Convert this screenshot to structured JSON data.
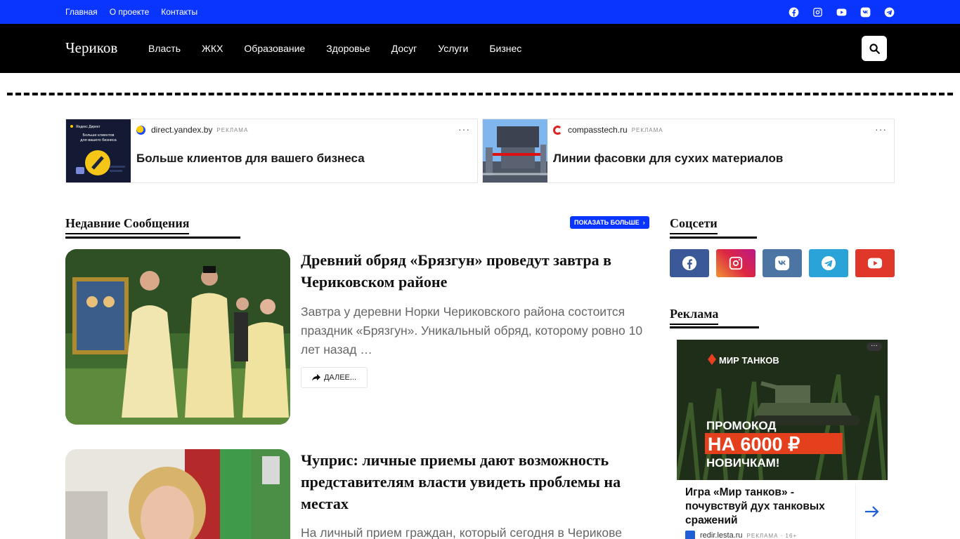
{
  "topbar": {
    "links": [
      "Главная",
      "О проекте",
      "Контакты"
    ],
    "social_icons": [
      "facebook-icon",
      "instagram-icon",
      "youtube-icon",
      "vk-icon",
      "telegram-icon"
    ]
  },
  "header": {
    "logo": "Чериков",
    "nav": [
      "Власть",
      "ЖКХ",
      "Образование",
      "Здоровье",
      "Досуг",
      "Услуги",
      "Бизнес"
    ],
    "search_icon": "search-icon"
  },
  "ads": [
    {
      "domain": "direct.yandex.by",
      "tag": "РЕКЛАМА",
      "headline": "Больше клиентов для вашего бизнеса",
      "thumb_text": "Больше клиентов для вашего бизнеса",
      "thumb_brand": "Яндекс Директ"
    },
    {
      "domain": "compasstech.ru",
      "tag": "РЕКЛАМА",
      "headline": "Линии фасовки для сухих материалов"
    }
  ],
  "recent": {
    "title": "Недавние Сообщения",
    "more_label": "ПОКАЗАТЬ БОЛЬШЕ",
    "posts": [
      {
        "title": "Древний обряд «Брязгун» проведут завтра в Чериковском районе",
        "excerpt": "Завтра у деревни Норки Чериковского района состоится праздник «Брязгун». Уникальный обряд, которому ровно 10 лет назад …",
        "read_more": "ДАЛЕЕ..."
      },
      {
        "title": "Чуприс: личные приемы дают возможность представителям власти увидеть проблемы на местах",
        "excerpt": "На личный прием граждан, который сегодня в Черикове"
      }
    ]
  },
  "sidebar": {
    "social_title": "Соцсети",
    "social_buttons": [
      {
        "icon": "facebook-icon",
        "color": "#3b5998"
      },
      {
        "icon": "instagram-icon",
        "color": "#c13584"
      },
      {
        "icon": "vk-icon",
        "color": "#4c75a3"
      },
      {
        "icon": "telegram-icon",
        "color": "#2aa3d9"
      },
      {
        "icon": "youtube-icon",
        "color": "#e0372b"
      }
    ],
    "ad_title": "Реклама",
    "ad": {
      "brand": "МИР ТАНКОВ",
      "promo1": "ПРОМОКОД",
      "promo2": "НА 6000 ₽",
      "promo3": "НОВИЧКАМ!",
      "caption": "Игра «Мир танков» - почувствуй дух танковых сражений",
      "domain": "redir.lesta.ru",
      "tag": "РЕКЛАМА · 16+"
    }
  },
  "colors": {
    "brand_blue": "#0a35ff",
    "header_bg": "#000000"
  }
}
